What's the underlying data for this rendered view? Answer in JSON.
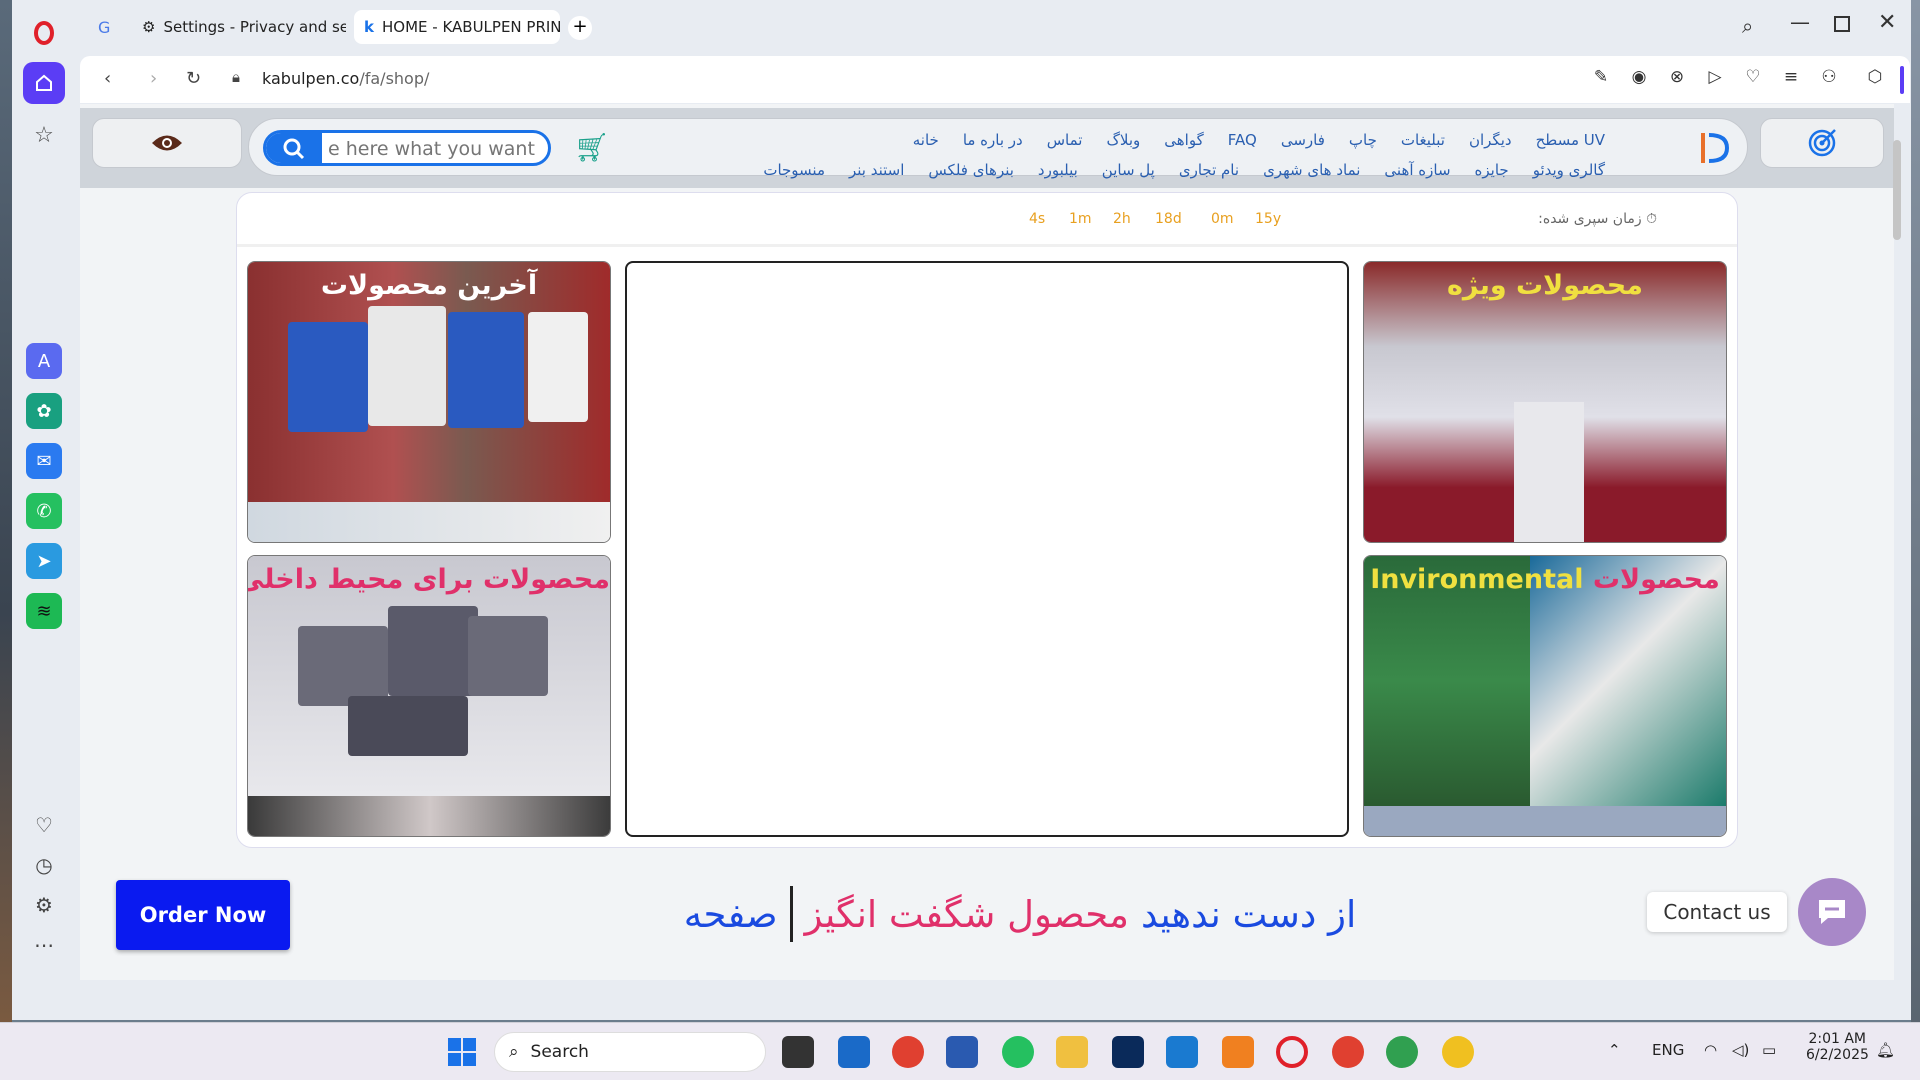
{
  "browser": {
    "tabs": [
      {
        "label": "Settings - Privacy and security",
        "icon": "gear-icon"
      },
      {
        "label": "HOME - KABULPEN PRINTING",
        "icon": "kabulpen-favicon"
      }
    ],
    "url_host": "kabulpen.co",
    "url_path": "/fa/shop/"
  },
  "header": {
    "search_placeholder": "e here what you want",
    "menu_row1": [
      "خانه",
      "در باره ما",
      "تماس",
      "وبلاگ",
      "گواهی",
      "FAQ",
      "فارسی",
      "چاپ",
      "تبلیغات",
      "دیگران",
      "UV مسطح"
    ],
    "menu_row2": [
      "منسوجات",
      "استند بنر",
      "بنرهای فلکس",
      "بیلبورد",
      "پل ساین",
      "نام تجاری",
      "نماد های شهری",
      "سازه آهنی",
      "جایزه",
      "گالری ویدئو"
    ]
  },
  "timer": {
    "label": "زمان سپری شده:",
    "values": [
      "15y",
      "0m",
      "18d",
      "2h",
      "1m",
      "4s"
    ]
  },
  "cards": {
    "top_left": "آخرین محصولات",
    "top_right": "محصولات ویژه",
    "bottom_left": "محصولات برای محیط داخلی",
    "bottom_right_en": "Invironmental",
    "bottom_right_fa": "محصولات"
  },
  "cta": {
    "order_label": "Order Now",
    "tag_part1": "از دست ندهید",
    "tag_part2": "محصول شگفت انگیز",
    "tag_part3": "صفحه",
    "contact_label": "Contact us"
  },
  "taskbar": {
    "search_label": "Search",
    "lang": "ENG",
    "time": "2:01 AM",
    "date": "6/2/2025"
  },
  "colors": {
    "accent": "#1a72e8",
    "opera": "#e0202a",
    "order": "#0a1af0",
    "pink": "#e0306a",
    "gold": "#e8a020"
  }
}
